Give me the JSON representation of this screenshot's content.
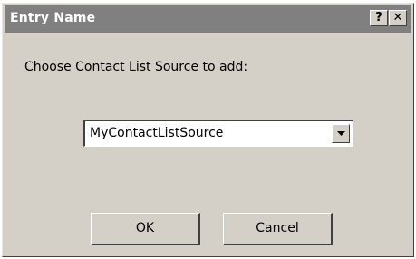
{
  "window": {
    "title": "Entry Name",
    "help_glyph": "?",
    "close_glyph": "✕"
  },
  "prompt": {
    "text": "Choose Contact List Source to add:"
  },
  "combo": {
    "selected": "MyContactListSource",
    "arrow_icon": "chevron-down-icon"
  },
  "buttons": {
    "ok_label": "OK",
    "cancel_label": "Cancel"
  },
  "colors": {
    "titlebar": "#808080",
    "dialog_bg": "#d4d0c8"
  }
}
